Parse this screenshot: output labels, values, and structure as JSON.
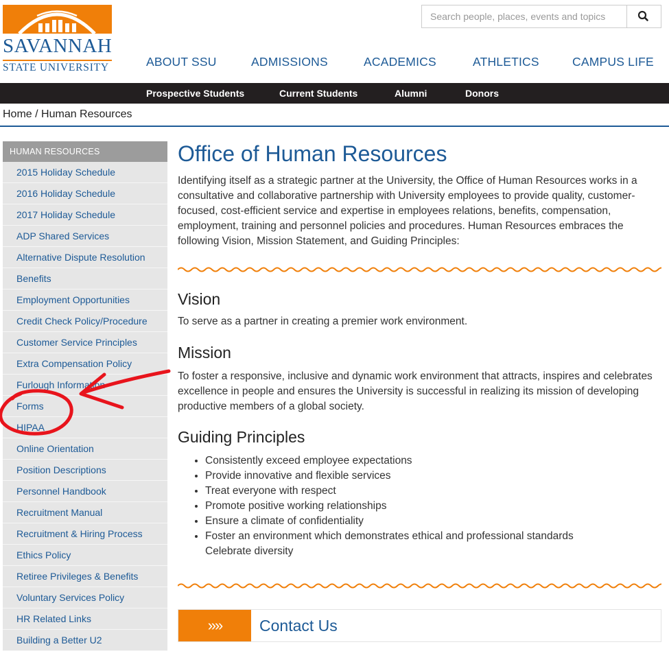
{
  "logo": {
    "name": "SAVANNAH",
    "subname": "STATE UNIVERSITY"
  },
  "search": {
    "placeholder": "Search people, places, events and topics"
  },
  "main_nav": [
    "ABOUT SSU",
    "ADMISSIONS",
    "ACADEMICS",
    "ATHLETICS",
    "CAMPUS LIFE"
  ],
  "audience_nav": [
    "Prospective Students",
    "Current Students",
    "Alumni",
    "Donors"
  ],
  "breadcrumb": {
    "home": "Home",
    "separator": " / ",
    "current": "Human Resources"
  },
  "sidebar": {
    "heading": "HUMAN RESOURCES",
    "items": [
      "2015 Holiday Schedule",
      "2016 Holiday Schedule",
      "2017 Holiday Schedule",
      "ADP Shared Services",
      "Alternative Dispute Resolution",
      "Benefits",
      "Employment Opportunities",
      "Credit Check Policy/Procedure",
      "Customer Service Principles",
      "Extra Compensation Policy",
      "Furlough Information",
      "Forms",
      "HIPAA",
      "Online Orientation",
      "Position Descriptions",
      "Personnel Handbook",
      "Recruitment Manual",
      "Recruitment & Hiring Process",
      "Ethics Policy",
      "Retiree Privileges & Benefits",
      "Voluntary Services Policy",
      "HR Related Links",
      "Building a Better U2"
    ]
  },
  "content": {
    "title": "Office of Human Resources",
    "intro": "Identifying itself as a strategic partner at the University, the Office of Human Resources works in a consultative and collaborative partnership with University employees to provide quality, customer-focused, cost-efficient service and expertise in employees relations, benefits, compensation, employment, training and personnel policies and procedures.  Human Resources embraces the following Vision, Mission Statement, and Guiding Principles:",
    "vision_heading": "Vision",
    "vision_text": "To serve as a partner in creating a premier work environment.",
    "mission_heading": "Mission",
    "mission_text": "To foster a responsive, inclusive and dynamic work environment that attracts, inspires and celebrates excellence in people and ensures the University is successful in realizing its mission of developing productive members of a global society.",
    "principles_heading": "Guiding Principles",
    "principles": [
      "Consistently exceed employee expectations",
      "Provide innovative and flexible services",
      "Treat everyone with respect",
      "Promote positive working relationships",
      "Ensure a climate of confidentiality",
      "Foster an environment which demonstrates ethical and professional standards",
      "Celebrate diversity"
    ]
  },
  "contact": {
    "arrow": "»»",
    "label": "Contact Us"
  },
  "colors": {
    "brand_blue": "#1d5a96",
    "brand_orange": "#f07f09",
    "annotation_red": "#e8141c",
    "sidebar_bg": "#e6e6e6"
  }
}
